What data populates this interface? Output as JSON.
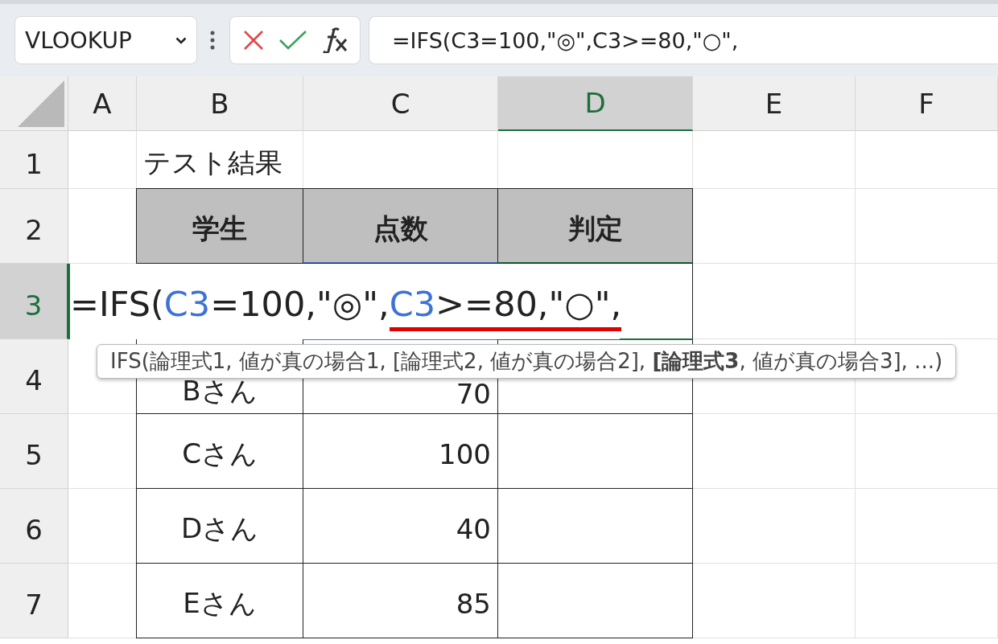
{
  "formula_bar": {
    "name_box": "VLOOKUP",
    "formula": "=IFS(C3=100,\"◎\",C3>=80,\"○\","
  },
  "columns": [
    {
      "label": "A",
      "selected": false
    },
    {
      "label": "B",
      "selected": false
    },
    {
      "label": "C",
      "selected": false
    },
    {
      "label": "D",
      "selected": true
    },
    {
      "label": "E",
      "selected": false
    },
    {
      "label": "F",
      "selected": false
    }
  ],
  "rows": [
    {
      "number": "1",
      "selected": false,
      "kind": "title",
      "title": "テスト結果"
    },
    {
      "number": "2",
      "selected": false,
      "kind": "header",
      "headings": [
        "学生",
        "点数",
        "判定"
      ]
    },
    {
      "number": "3",
      "selected": true,
      "kind": "edit"
    },
    {
      "number": "4",
      "selected": false,
      "kind": "data",
      "student": "Bさん",
      "score": "70"
    },
    {
      "number": "5",
      "selected": false,
      "kind": "data",
      "student": "Cさん",
      "score": "100"
    },
    {
      "number": "6",
      "selected": false,
      "kind": "data",
      "student": "Dさん",
      "score": "40"
    },
    {
      "number": "7",
      "selected": false,
      "kind": "data",
      "student": "Eさん",
      "score": "85"
    }
  ],
  "cell_editor": {
    "segments": [
      {
        "kind": "text",
        "text": "=IFS(",
        "underlined": false
      },
      {
        "kind": "ref",
        "text": "C3",
        "underlined": false
      },
      {
        "kind": "text",
        "text": "=100,\"◎\",",
        "underlined": false
      },
      {
        "kind": "ref",
        "text": "C3",
        "underlined": true
      },
      {
        "kind": "text",
        "text": ">=80,\"○\",",
        "underlined": true
      }
    ]
  },
  "tooltip": "IFS(論理式1, 値が真の場合1, [論理式2, 値が真の場合2], **[論理式3**, 値が真の場合3], ...)"
}
